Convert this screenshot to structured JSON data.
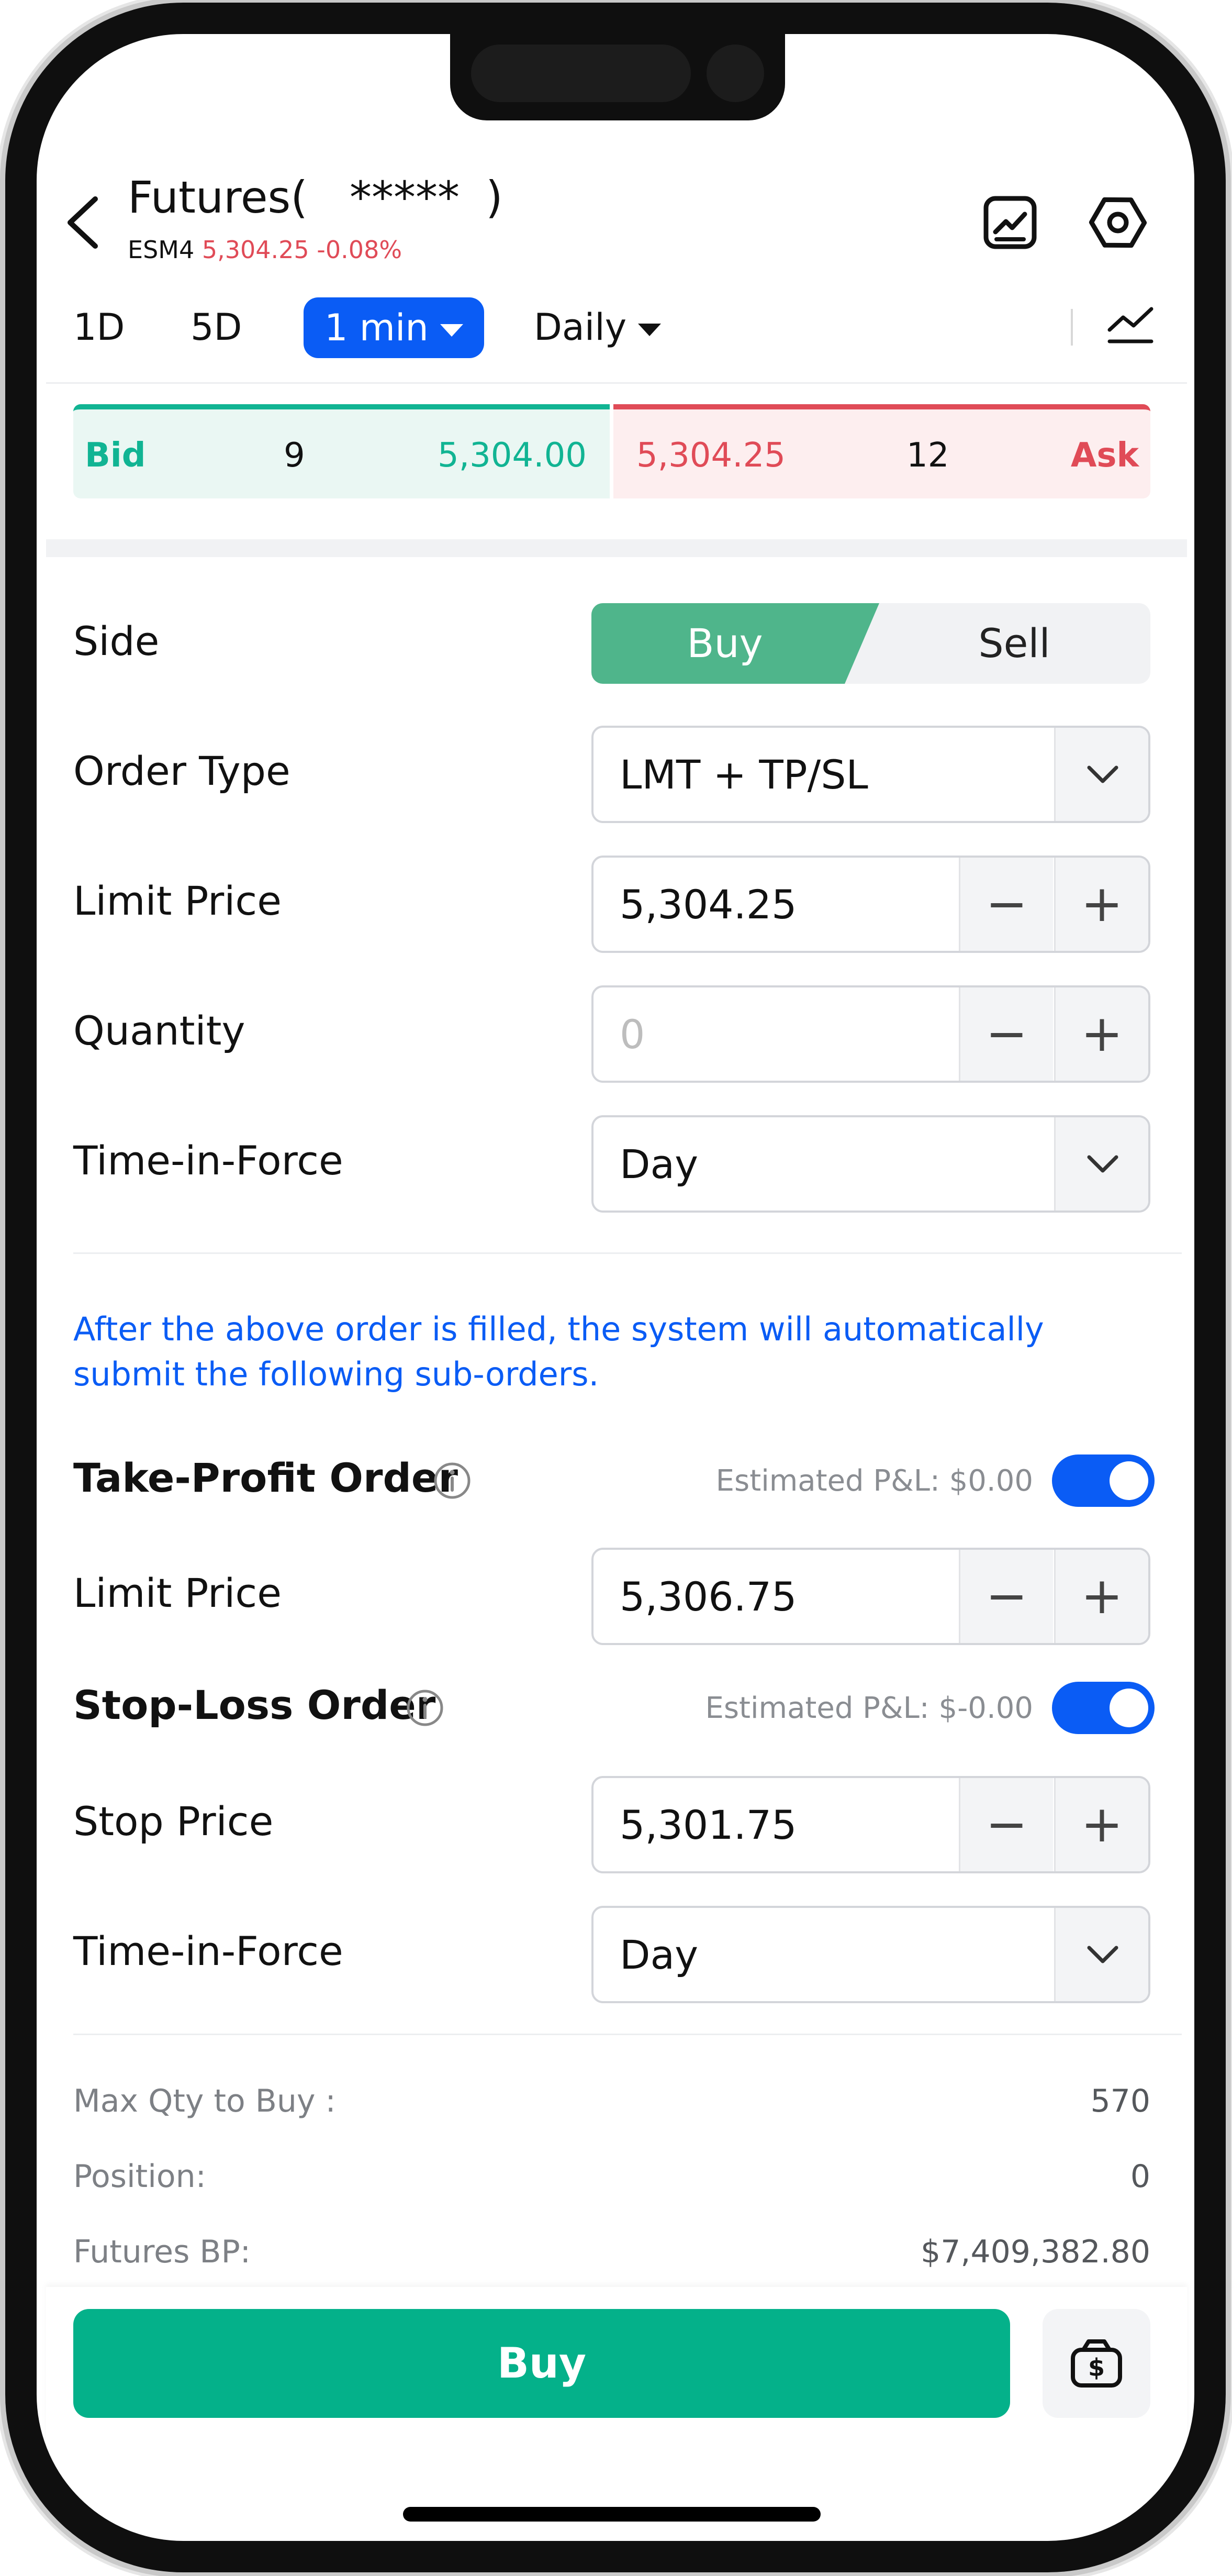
{
  "header": {
    "title_prefix": "Futures(",
    "title_masked": "*****",
    "title_suffix": ")",
    "symbol": "ESM4",
    "price_change": "5,304.25 -0.08%"
  },
  "timeframes": [
    {
      "label": "1D"
    },
    {
      "label": "5D"
    },
    {
      "label": "1 min",
      "active": true
    },
    {
      "label": "Daily"
    }
  ],
  "quote": {
    "bid_label": "Bid",
    "bid_size": "9",
    "bid_price": "5,304.00",
    "ask_price": "5,304.25",
    "ask_size": "12",
    "ask_label": "Ask"
  },
  "order": {
    "side_label": "Side",
    "buy_label": "Buy",
    "sell_label": "Sell",
    "order_type_label": "Order Type",
    "order_type_value": "LMT + TP/SL",
    "limit_price_label": "Limit Price",
    "limit_price_value": "5,304.25",
    "quantity_label": "Quantity",
    "quantity_placeholder": "0",
    "tif_label": "Time-in-Force",
    "tif_value": "Day"
  },
  "note": "After the above order is filled, the system will automatically submit the following sub-orders.",
  "take_profit": {
    "title": "Take-Profit Order",
    "estimated": "Estimated P&L: $0.00",
    "enabled": true,
    "price_label": "Limit Price",
    "price_value": "5,306.75"
  },
  "stop_loss": {
    "title": "Stop-Loss Order",
    "estimated": "Estimated P&L: $-0.00",
    "enabled": true,
    "price_label": "Stop Price",
    "price_value": "5,301.75",
    "tif_label": "Time-in-Force",
    "tif_value": "Day"
  },
  "summary": [
    {
      "label": "Max Qty to Buy :",
      "value": "570"
    },
    {
      "label": "Position:",
      "value": "0"
    },
    {
      "label": "Futures BP:",
      "value": "$7,409,382.80"
    }
  ],
  "footer": {
    "buy_button": "Buy"
  },
  "colors": {
    "accent": "#0a5cf5",
    "bid": "#11b493",
    "ask": "#e04b57",
    "buy_button": "#04b18a",
    "side_buy": "#4fb58b"
  },
  "icons": [
    "back-arrow-icon",
    "chart-edit-icon",
    "settings-hexagon-icon",
    "chart-indicator-icon",
    "chevron-down-icon",
    "info-icon",
    "cash-wallet-icon"
  ]
}
